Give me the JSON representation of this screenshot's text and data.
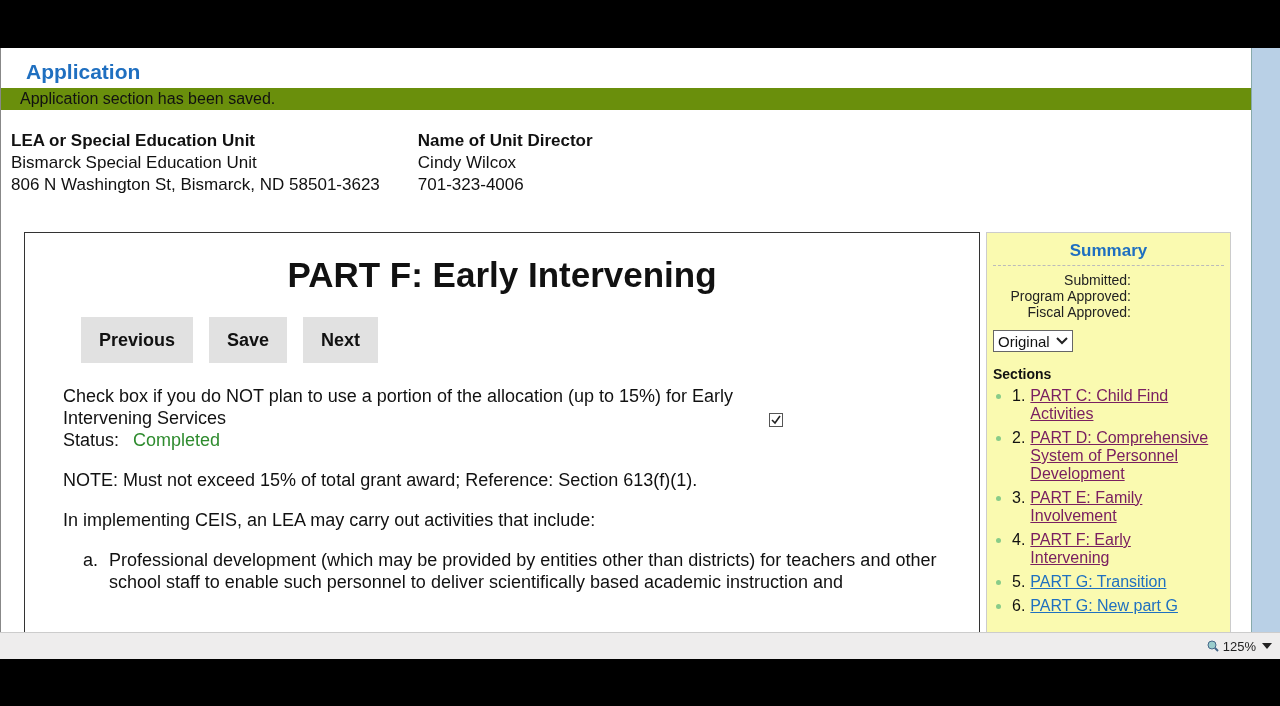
{
  "page": {
    "title": "Application",
    "notice": "Application section has been saved."
  },
  "contacts": [
    {
      "heading": "LEA or Special Education Unit",
      "lines": [
        "Bismarck Special Education Unit",
        "806 N Washington St, Bismarck, ND 58501-3623"
      ]
    },
    {
      "heading": "Name of Unit Director",
      "lines": [
        "Cindy Wilcox",
        "701-323-4006"
      ]
    }
  ],
  "main": {
    "heading": "PART F: Early Intervening",
    "buttons": [
      "Previous",
      "Save",
      "Next"
    ],
    "checkbox": {
      "label": "Check box if you do NOT plan to use a portion of the allocation (up to 15%) for Early Intervening Services",
      "checked": true
    },
    "status_label": "Status:",
    "status": "Completed",
    "note": "NOTE: Must not exceed 15% of total grant award; Reference: Section 613(f)(1).",
    "intro": "In implementing CEIS, an LEA may carry out activities that include:",
    "items": [
      {
        "marker": "a.",
        "text": "Professional development (which may be provided by entities other than districts) for teachers and other school staff to enable such personnel to deliver scientifically based academic instruction and"
      }
    ]
  },
  "summary": {
    "title": "Summary",
    "fields": [
      "Submitted:",
      "Program Approved:",
      "Fiscal Approved:"
    ],
    "version": "Original",
    "sections_title": "Sections",
    "sections": [
      {
        "number": "1.",
        "label": "PART C: Child Find Activities",
        "visited": true
      },
      {
        "number": "2.",
        "label": "PART D: Comprehensive System of Personnel Development",
        "visited": true
      },
      {
        "number": "3.",
        "label": "PART E: Family Involvement",
        "visited": true
      },
      {
        "number": "4.",
        "label": "PART F: Early Intervening",
        "visited": true
      },
      {
        "number": "5.",
        "label": "PART G: Transition",
        "visited": false
      },
      {
        "number": "6.",
        "label": "PART G: New part G",
        "visited": false
      }
    ]
  },
  "status_bar": {
    "zoom": "125%"
  }
}
